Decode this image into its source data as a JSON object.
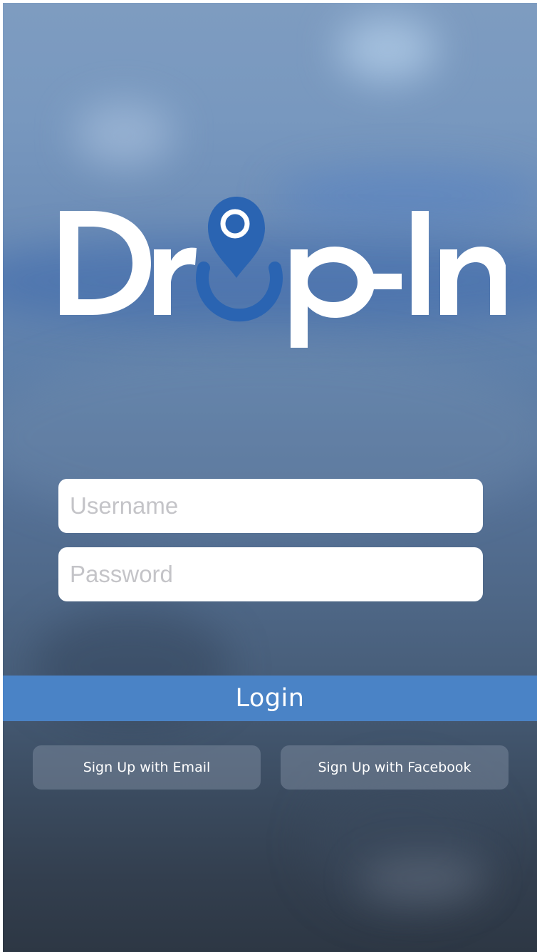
{
  "app": {
    "logo_text": "Drop-In"
  },
  "form": {
    "username_placeholder": "Username",
    "username_value": "",
    "password_placeholder": "Password",
    "password_value": ""
  },
  "actions": {
    "login_label": "Login",
    "signup_email_label": "Sign Up with Email",
    "signup_facebook_label": "Sign Up with Facebook"
  },
  "colors": {
    "accent": "#4a83c6",
    "logo_pin": "#2a64b2",
    "logo_text": "#ffffff"
  }
}
